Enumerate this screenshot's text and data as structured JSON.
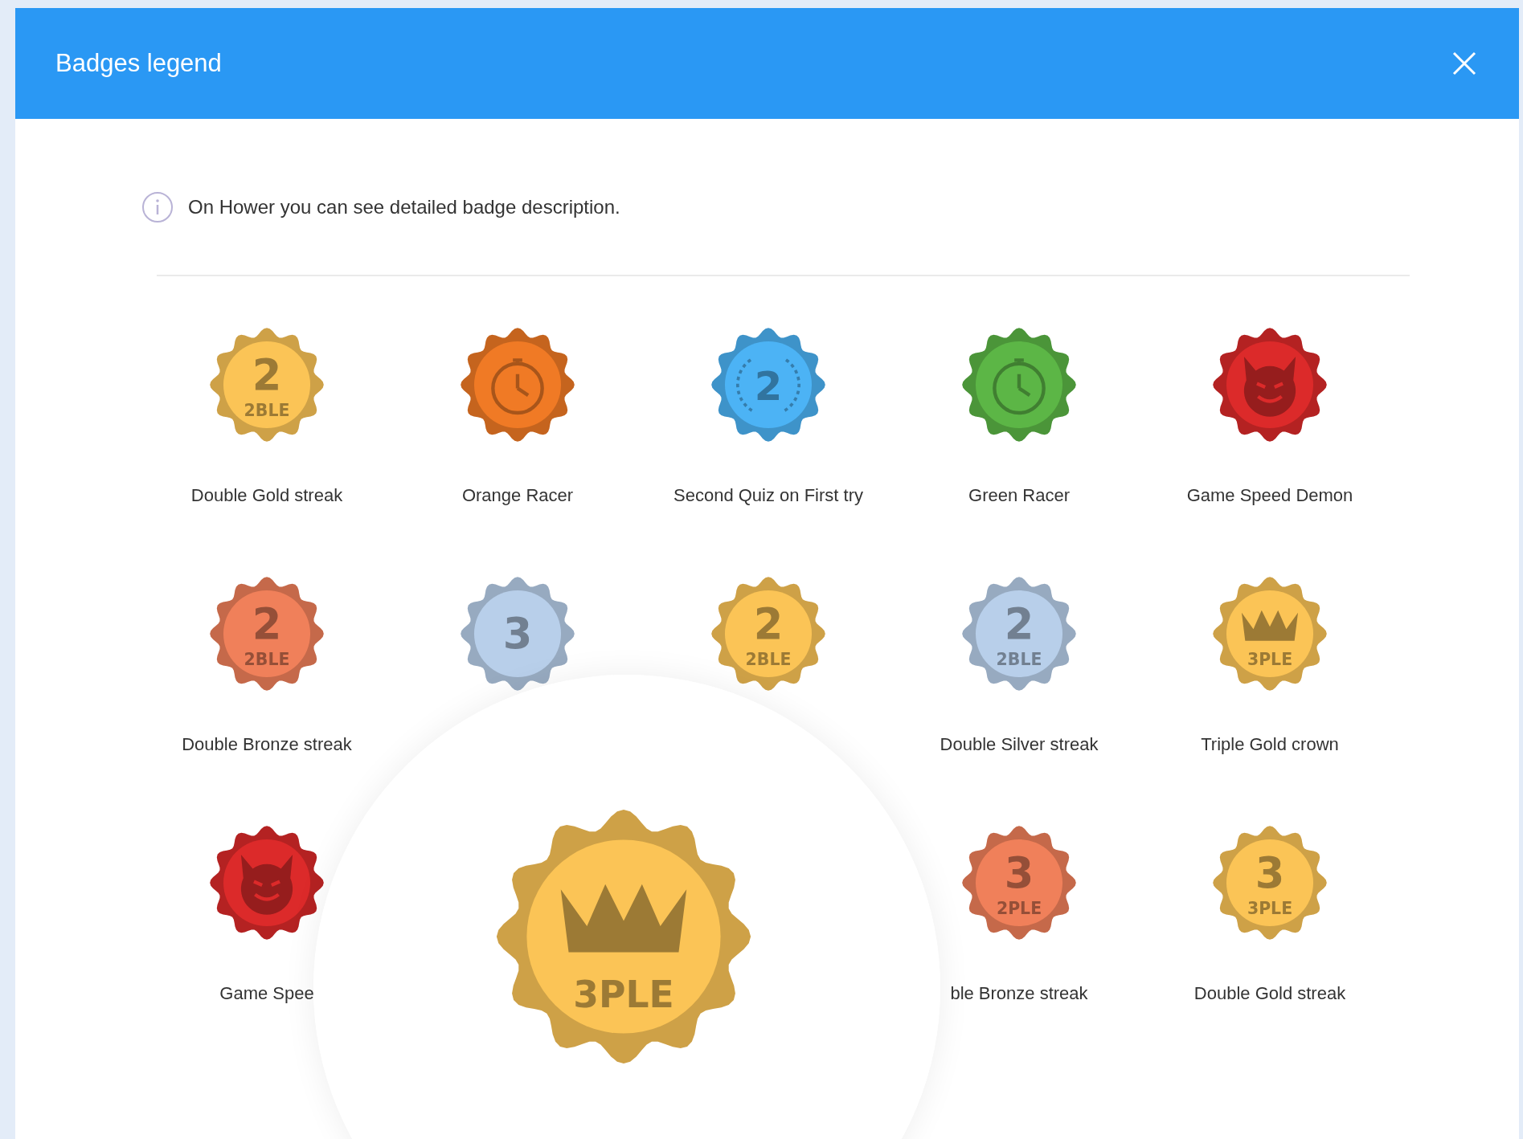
{
  "dialog": {
    "title": "Badges legend"
  },
  "info": {
    "text": "On Hower you can see detailed badge description."
  },
  "badge_rows": [
    [
      {
        "kind": "number",
        "label": "Double Gold streak",
        "color": "#fbc456",
        "number": "2",
        "tag": "2BLE"
      },
      {
        "kind": "stopwatch",
        "label": "Orange Racer",
        "color": "#f07a25"
      },
      {
        "kind": "laurel",
        "label": "Second Quiz on First try",
        "color": "#4cb3f5",
        "number": "2"
      },
      {
        "kind": "stopwatch",
        "label": "Green Racer",
        "color": "#5cb646"
      },
      {
        "kind": "devil",
        "label": "Game Speed Demon",
        "color": "#dc2a2a"
      }
    ],
    [
      {
        "kind": "number",
        "label": "Double Bronze streak",
        "color": "#f0805a",
        "number": "2",
        "tag": "2BLE"
      },
      {
        "kind": "number",
        "color": "#b8cfea",
        "number": "3"
      },
      {
        "kind": "number",
        "color": "#fbc456",
        "number": "2",
        "tag": "2BLE"
      },
      {
        "kind": "number",
        "label": "Double Silver streak",
        "color": "#b8cfea",
        "number": "2",
        "tag": "2BLE"
      },
      {
        "kind": "crown",
        "label": "Triple Gold crown",
        "color": "#fbc456",
        "tag": "3PLE"
      }
    ],
    [
      {
        "kind": "devil",
        "label": "Game Spee",
        "color": "#dc2a2a"
      },
      {
        "kind": "covered"
      },
      {
        "kind": "covered"
      },
      {
        "kind": "number",
        "label": "ble Bronze streak",
        "color": "#f0805a",
        "number": "3",
        "tag": "2PLE"
      },
      {
        "kind": "number",
        "label": "Double Gold streak",
        "color": "#fbc456",
        "number": "3",
        "tag": "3PLE"
      }
    ]
  ],
  "magnifier": {
    "badge": {
      "kind": "crown",
      "color": "#fbc456",
      "tag": "3PLE"
    }
  }
}
